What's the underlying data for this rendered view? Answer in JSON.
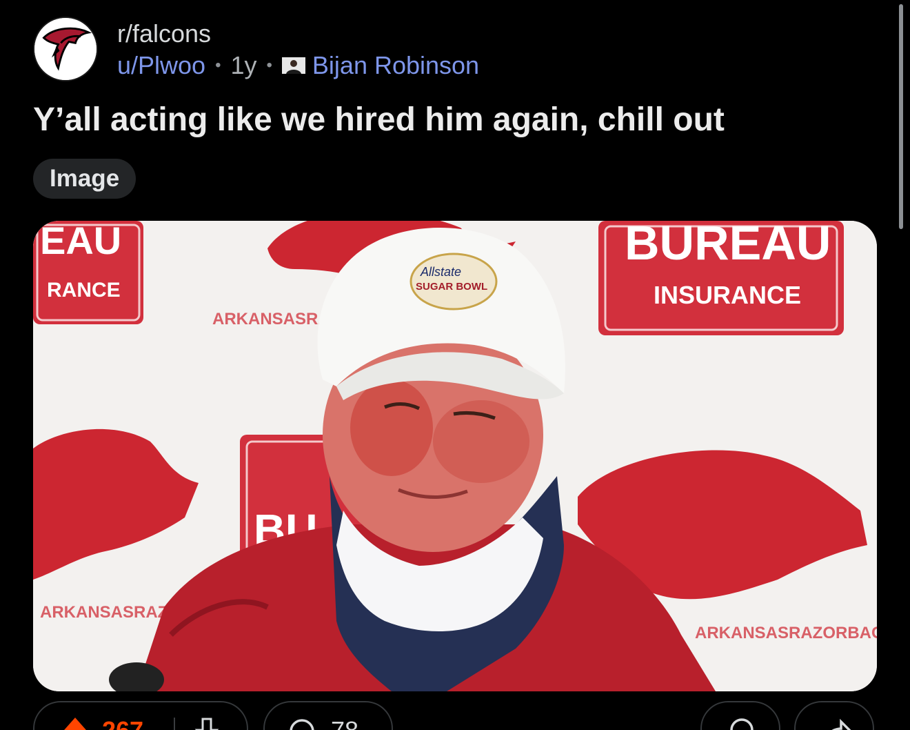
{
  "post": {
    "subreddit": "r/falcons",
    "author": "u/Plwoo",
    "age": "1y",
    "separator": "•",
    "user_flair": "Bijan Robinson",
    "title": "Y’all acting like we hired him again, chill out",
    "tag": "Image"
  },
  "media": {
    "alt_icon": "press-conference-photo",
    "cap_text_line1": "Allstate",
    "cap_text_line2": "SUGAR BOWL",
    "banner_word_right": "BUREAU",
    "banner_word_right_sub": "INSURANCE",
    "banner_word_left": "EAU",
    "banner_word_left_sub": "RANCE",
    "banner_word_center": "BU",
    "website_text": "ARKANSASRAZORBACKS.COM"
  },
  "actions": {
    "upvote_count": "267",
    "comment_count": "78",
    "upvote_icon": "upvote-arrow-icon",
    "downvote_icon": "downvote-arrow-icon",
    "comment_icon": "comment-bubble-icon",
    "award_icon": "award-icon",
    "share_icon": "share-icon"
  },
  "colors": {
    "background": "#000000",
    "link": "#7e96ea",
    "upvote": "#ff4500",
    "pill_bg": "#232527"
  }
}
